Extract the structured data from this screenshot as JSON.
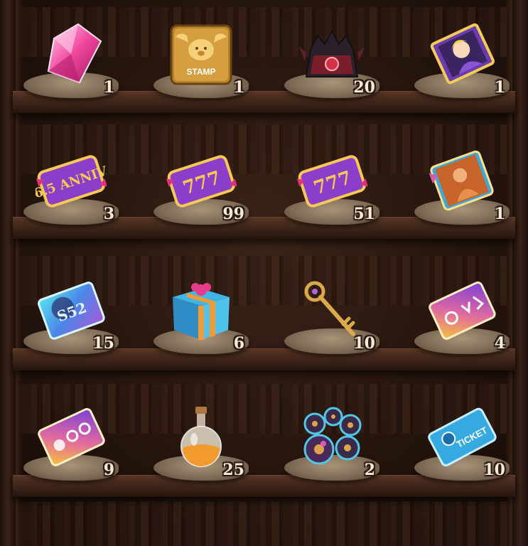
{
  "rows": [
    [
      {
        "icon": "pink-crystal-icon",
        "count": "1"
      },
      {
        "icon": "stamp-card-icon",
        "count": "1",
        "label": "STAMP"
      },
      {
        "icon": "demon-armor-chest-icon",
        "count": "20"
      },
      {
        "icon": "hero-portrait-ticket-icon",
        "count": "1"
      }
    ],
    [
      {
        "icon": "anniversary-ticket-icon",
        "count": "3",
        "label": "6.5 ANNIV."
      },
      {
        "icon": "777-ticket-icon",
        "count": "99",
        "label": "777"
      },
      {
        "icon": "777-ticket-icon",
        "count": "51",
        "label": "777"
      },
      {
        "icon": "character-coupon-icon",
        "count": "1"
      }
    ],
    [
      {
        "icon": "season-52-ticket-icon",
        "count": "15",
        "label": "S52"
      },
      {
        "icon": "gift-box-icon",
        "count": "6"
      },
      {
        "icon": "gold-key-icon",
        "count": "10"
      },
      {
        "icon": "attribute-ticket-icon",
        "count": "4"
      }
    ],
    [
      {
        "icon": "race-ticket-icon",
        "count": "9"
      },
      {
        "icon": "potion-flask-icon",
        "count": "25"
      },
      {
        "icon": "ornament-orbs-icon",
        "count": "2"
      },
      {
        "icon": "blue-ticket-icon",
        "count": "10",
        "label": "TICKET"
      }
    ]
  ]
}
